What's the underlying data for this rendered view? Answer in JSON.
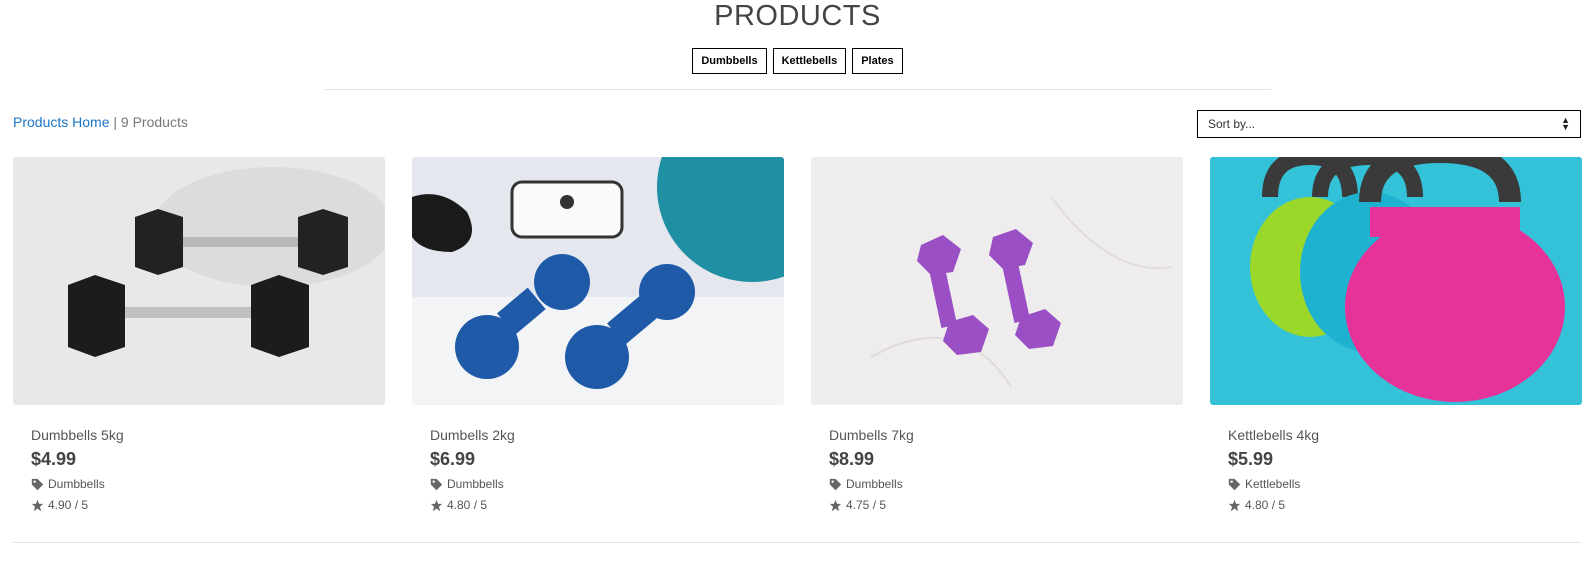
{
  "page": {
    "title": "PRODUCTS"
  },
  "categories": [
    "Dumbbells",
    "Kettlebells",
    "Plates"
  ],
  "breadcrumb": {
    "home_label": "Products Home",
    "separator": "|",
    "count_label": "9 Products"
  },
  "sort": {
    "selected": "Sort by..."
  },
  "products": [
    {
      "name": "Dumbbells 5kg",
      "price": "$4.99",
      "category": "Dumbbells",
      "rating": "4.90 / 5"
    },
    {
      "name": "Dumbells 2kg",
      "price": "$6.99",
      "category": "Dumbbells",
      "rating": "4.80 / 5"
    },
    {
      "name": "Dumbells 7kg",
      "price": "$8.99",
      "category": "Dumbbells",
      "rating": "4.75 / 5"
    },
    {
      "name": "Kettlebells 4kg",
      "price": "$5.99",
      "category": "Kettlebells",
      "rating": "4.80 / 5"
    }
  ],
  "icons": {
    "category": "tag-icon",
    "rating": "star-icon",
    "sort": "sort-arrows-icon"
  },
  "colors": {
    "link": "#1a74c4",
    "text": "#555555",
    "rule": "#e2e2e2"
  }
}
